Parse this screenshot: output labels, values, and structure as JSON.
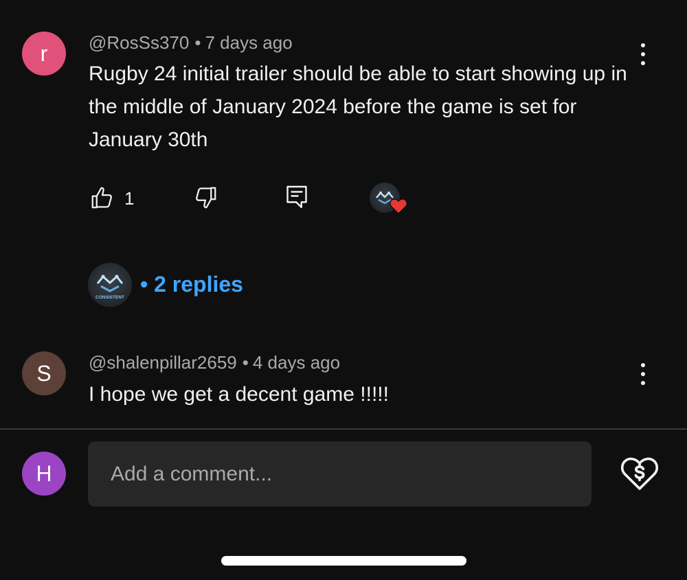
{
  "comments": [
    {
      "avatar_letter": "r",
      "avatar_color": "#e0527a",
      "handle": "@RosSs370",
      "time": "7 days ago",
      "text": "Rugby 24 initial trailer should be able to start showing up in the middle of January 2024 before the game is set for January 30th",
      "like_count": "1",
      "replies_label": "2 replies"
    },
    {
      "avatar_letter": "S",
      "avatar_color": "#5d4037",
      "handle": "@shalenpillar2659",
      "time": "4 days ago",
      "text": "I hope we get a decent game !!!!!"
    }
  ],
  "composer": {
    "avatar_letter": "H",
    "avatar_color": "#9c44c4",
    "placeholder": "Add a comment..."
  },
  "channel_logo_text": "CONSISTENT",
  "colors": {
    "background": "#0f0f0f",
    "link": "#3ea6ff",
    "heart": "#e53935"
  }
}
